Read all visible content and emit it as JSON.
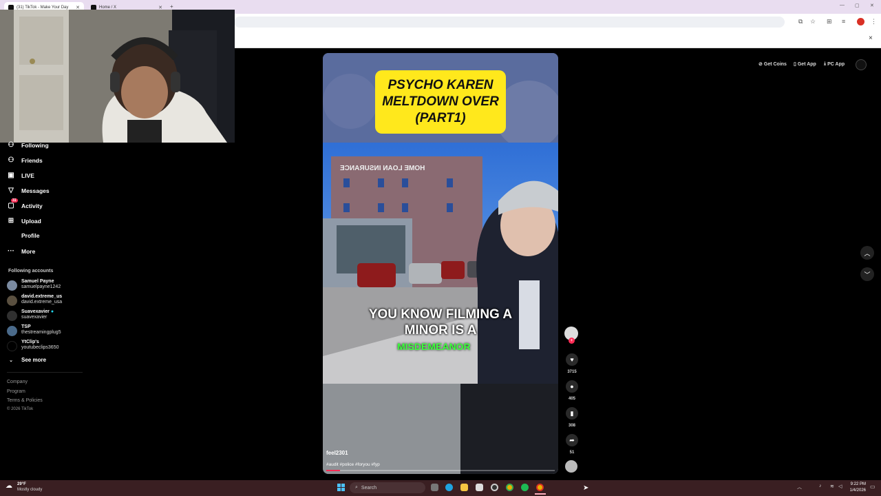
{
  "browser": {
    "tabs": [
      {
        "title": "(31) TikTok - Make Your Day"
      },
      {
        "title": "Home / X"
      }
    ],
    "new_tab": "+",
    "tab_close": "✕",
    "window_controls": {
      "minimize": "—",
      "maximize": "▢",
      "close": "✕"
    },
    "infobar_close": "×"
  },
  "header": {
    "get_coins": "Get Coins",
    "get_app": "Get App",
    "pc_app": "PC App"
  },
  "sidebar": {
    "nav": [
      {
        "label": "Following",
        "icon": "following-icon"
      },
      {
        "label": "Friends",
        "icon": "friends-icon"
      },
      {
        "label": "LIVE",
        "icon": "live-icon"
      },
      {
        "label": "Messages",
        "icon": "messages-icon"
      },
      {
        "label": "Activity",
        "icon": "activity-icon",
        "badge": "31"
      },
      {
        "label": "Upload",
        "icon": "upload-icon"
      },
      {
        "label": "Profile",
        "icon": "profile-icon"
      },
      {
        "label": "More",
        "icon": "more-icon"
      }
    ],
    "following_header": "Following accounts",
    "accounts": [
      {
        "name": "Samuel Payne",
        "handle": "samuelpayne1242"
      },
      {
        "name": "david.extreme_us",
        "handle": "david.extreme_usa"
      },
      {
        "name": "Suavexavier",
        "handle": "suavexavier"
      },
      {
        "name": "TSP",
        "handle": "thestreamingplug5"
      },
      {
        "name": "YtClip's",
        "handle": "youtubeclips3650"
      }
    ],
    "see_more": "See more",
    "footer": [
      "Company",
      "Program",
      "Terms & Policies",
      "© 2026 TikTok"
    ]
  },
  "video": {
    "title_lines": [
      "PSYCHO KAREN",
      "MELTDOWN OVER",
      "(PART1)"
    ],
    "building_sign": "HOME LOAN INSURANCE",
    "caption_lines": [
      "YOU KNOW FILMING A",
      "MINOR IS A"
    ],
    "caption_highlight": "MISDEMEANOR",
    "author": "feel2301",
    "hashtags": "#audit #police #foryou #fyp",
    "progress": 0.06
  },
  "actions": {
    "likes": "3715",
    "comments": "405",
    "saves": "308",
    "shares": "51"
  },
  "taskbar": {
    "weather_temp": "29°F",
    "weather_desc": "Mostly cloudy",
    "search_placeholder": "Search",
    "time": "9:22 PM",
    "date": "1/4/2026"
  },
  "colors": {
    "tiktok_red": "#fe2c55",
    "caption_green": "#3dff3d",
    "title_yellow": "#ffe81c",
    "taskbar": "#3a1f22",
    "tabbar": "#e9ddf0"
  }
}
